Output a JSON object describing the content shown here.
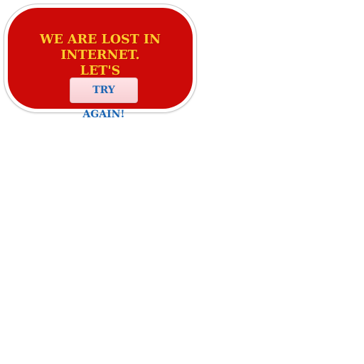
{
  "dialog": {
    "message_line1": "We are lost in  internet.",
    "message_line2": "Let's",
    "button_label": "Try again!"
  },
  "colors": {
    "panel_background": "#cc0a08",
    "message_text": "#ffcd2e",
    "button_background": "#f9d6da",
    "button_text": "#1d66b3"
  }
}
